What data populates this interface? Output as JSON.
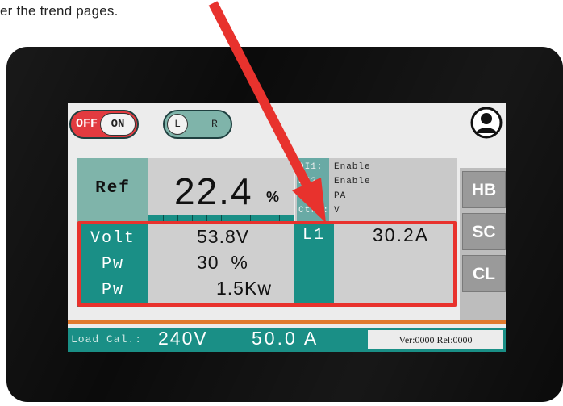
{
  "caption": "er the trend pages.",
  "toggles": {
    "power_off": "OFF",
    "power_on": "ON",
    "side_left": "L",
    "side_right": "R"
  },
  "icons": {
    "user": "user-icon"
  },
  "ref": {
    "label": "Ref",
    "value": "22.4",
    "unit": "%"
  },
  "digital_inputs": [
    {
      "name": "DI1:",
      "value": "Enable"
    },
    {
      "name": "DI2:",
      "value": "Enable"
    },
    {
      "name": "Cur:",
      "value": "PA"
    },
    {
      "name": "Ctrl:",
      "value": "V"
    }
  ],
  "side_buttons": [
    "HB",
    "SC",
    "CL"
  ],
  "readings": {
    "volt_label": "Volt",
    "volt_value": "53.8V",
    "pw1_label": "Pw",
    "pw1_value": "30  %",
    "pw2_label": "Pw",
    "pw2_value": "1.5Kw",
    "l1_label": "L1",
    "l1_value": "30.2A"
  },
  "status": {
    "label": "Load Cal.:",
    "voltage": "240V",
    "current": "50.0 A",
    "version": "Ver:0000  Rel:0000"
  },
  "colors": {
    "teal": "#1a8f86",
    "light_teal": "#7fb4aa",
    "highlight_red": "#e8322d",
    "orange_divider": "#e07a2e",
    "off_red": "#e23b40"
  }
}
